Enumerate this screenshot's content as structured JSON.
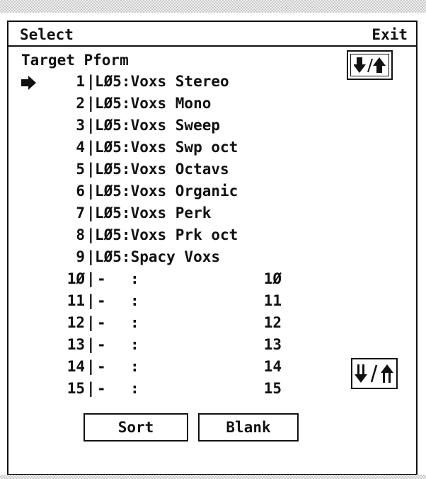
{
  "menu": {
    "select_label": "Select",
    "exit_label": "Exit"
  },
  "header": {
    "title": "Target Pform"
  },
  "icons": {
    "pointer": "right-pointer-arrow-icon",
    "sort_toggle": "down-up-arrow-toggle-icon",
    "page_toggle": "double-down-up-arrow-icon"
  },
  "entries": [
    {
      "num": "1",
      "name": "LØ5:Voxs Stereo"
    },
    {
      "num": "2",
      "name": "LØ5:Voxs Mono"
    },
    {
      "num": "3",
      "name": "LØ5:Voxs Sweep"
    },
    {
      "num": "4",
      "name": "LØ5:Voxs Swp oct"
    },
    {
      "num": "5",
      "name": "LØ5:Voxs Octavs"
    },
    {
      "num": "6",
      "name": "LØ5:Voxs Organic"
    },
    {
      "num": "7",
      "name": "LØ5:Voxs Perk"
    },
    {
      "num": "8",
      "name": "LØ5:Voxs Prk oct"
    },
    {
      "num": "9",
      "name": "LØ5:Spacy Voxs"
    }
  ],
  "empty_entries": [
    {
      "num": "1Ø",
      "dash": "-",
      "colon": ":",
      "value": "1Ø"
    },
    {
      "num": "11",
      "dash": "-",
      "colon": ":",
      "value": "11"
    },
    {
      "num": "12",
      "dash": "-",
      "colon": ":",
      "value": "12"
    },
    {
      "num": "13",
      "dash": "-",
      "colon": ":",
      "value": "13"
    },
    {
      "num": "14",
      "dash": "-",
      "colon": ":",
      "value": "14"
    },
    {
      "num": "15",
      "dash": "-",
      "colon": ":",
      "value": "15"
    }
  ],
  "buttons": {
    "sort_label": "Sort",
    "blank_label": "Blank"
  }
}
